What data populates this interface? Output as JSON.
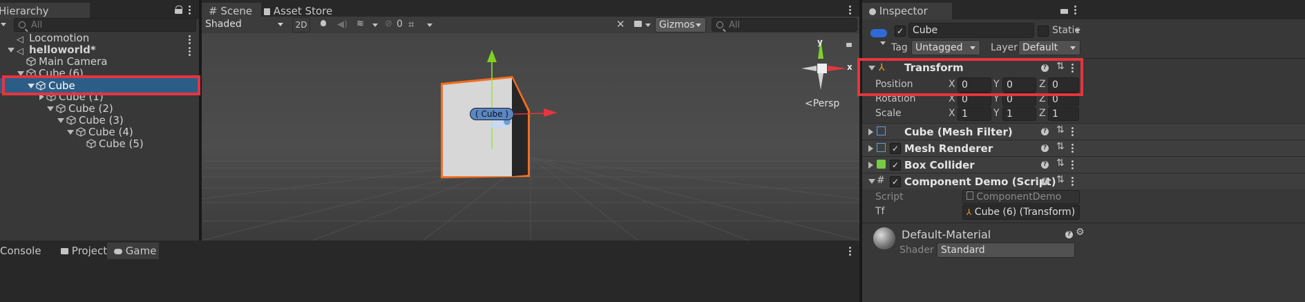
{
  "hierarchy": {
    "tab_label": "Hierarchy",
    "search_placeholder": "All",
    "items": [
      {
        "label": "Locomotion"
      },
      {
        "label": "helloworld*"
      },
      {
        "label": "Main Camera"
      },
      {
        "label": "Cube (6)"
      },
      {
        "label": "Cube"
      },
      {
        "label": "Cube (1)"
      },
      {
        "label": "Cube (2)"
      },
      {
        "label": "Cube (3)"
      },
      {
        "label": "Cube (4)"
      },
      {
        "label": "Cube (5)"
      }
    ]
  },
  "scene": {
    "tabs": [
      {
        "label": "Scene"
      },
      {
        "label": "Asset Store"
      }
    ],
    "shading_mode": "Shaded",
    "btn_2d": "2D",
    "hidden_count": "0",
    "gizmos_label": "Gizmos",
    "search_placeholder": "All",
    "object_label": "Cube",
    "gizmo_axes": {
      "y": "y",
      "x": "x"
    },
    "persp_label": "Persp"
  },
  "bottom_tabs": [
    {
      "label": "Console"
    },
    {
      "label": "Project"
    },
    {
      "label": "Game"
    }
  ],
  "inspector": {
    "tab_label": "Inspector",
    "object_name": "Cube",
    "static_label": "Static",
    "tag_label": "Tag",
    "tag_value": "Untagged",
    "layer_label": "Layer",
    "layer_value": "Default",
    "transform": {
      "title": "Transform",
      "position": {
        "label": "Position",
        "x": "0",
        "y": "0",
        "z": "0"
      },
      "rotation": {
        "label": "Rotation",
        "x": "0",
        "y": "0",
        "z": "0"
      },
      "scale": {
        "label": "Scale",
        "x": "1",
        "y": "1",
        "z": "1"
      },
      "axis_x": "X",
      "axis_y": "Y",
      "axis_z": "Z"
    },
    "components": [
      {
        "title": "Cube (Mesh Filter)"
      },
      {
        "title": "Mesh Renderer"
      },
      {
        "title": "Box Collider"
      },
      {
        "title": "Component Demo (Script)"
      }
    ],
    "script_label": "Script",
    "script_value": "ComponentDemo",
    "tf_label": "Tf",
    "tf_value": "Cube (6) (Transform)",
    "material_name": "Default-Material",
    "shader_label": "Shader",
    "shader_value": "Standard"
  },
  "colors": {
    "highlight_red": "#e8343e",
    "selection_blue": "#2c5d87",
    "outline_orange": "#f26e1f"
  }
}
